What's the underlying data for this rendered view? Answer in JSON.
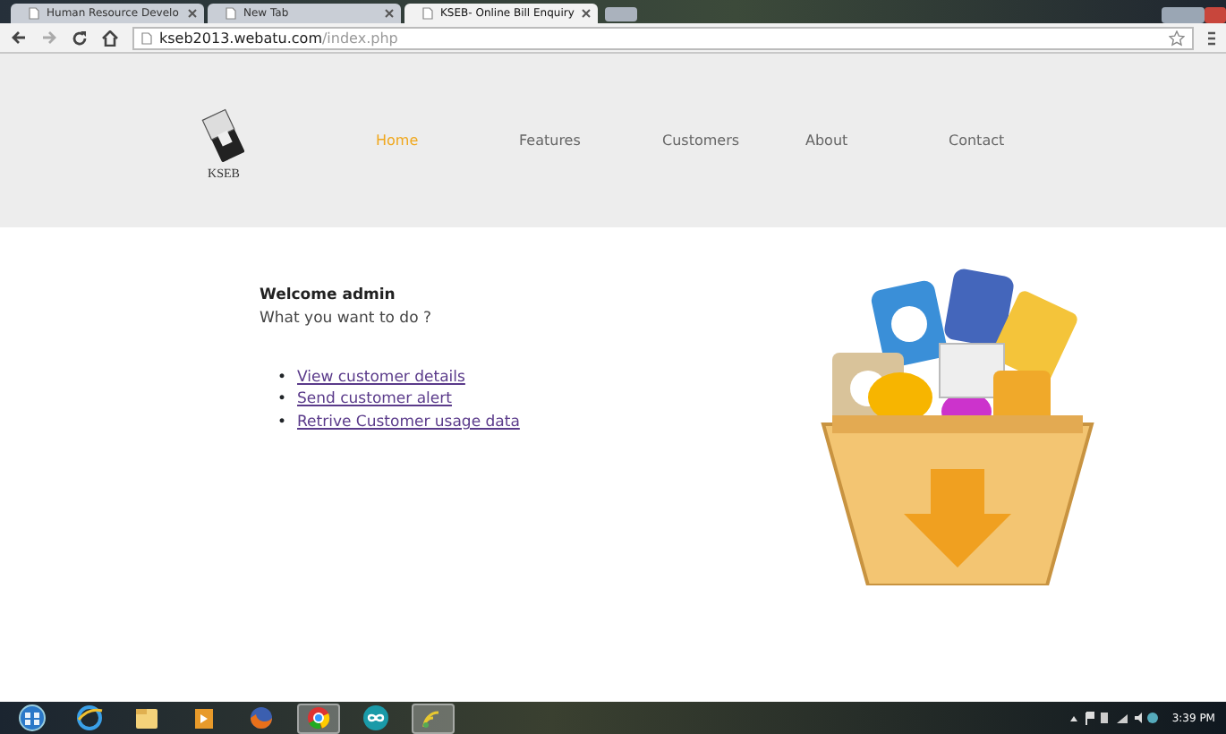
{
  "browser": {
    "tabs": [
      {
        "label": "Human Resource Develo",
        "selected": false
      },
      {
        "label": "New Tab",
        "selected": false
      },
      {
        "label": "KSEB- Online Bill Enquiry",
        "selected": true
      }
    ],
    "address": {
      "host": "kseb2013.webatu.com",
      "path": "/index.php"
    }
  },
  "site": {
    "logo_text": "KSEB",
    "nav": [
      {
        "label": "Home",
        "selected": true
      },
      {
        "label": "Features",
        "selected": false
      },
      {
        "label": "Customers",
        "selected": false
      },
      {
        "label": "About",
        "selected": false
      },
      {
        "label": "Contact",
        "selected": false
      }
    ]
  },
  "content": {
    "greeting": "Welcome admin",
    "prompt": "What you want to do ?",
    "links": [
      {
        "bullet": "•",
        "label": "View customer details"
      },
      {
        "bullet": "•",
        "label": "Send customer alert"
      },
      {
        "bullet": "•",
        "label": "Retrive Customer usage data"
      }
    ]
  },
  "taskbar": {
    "apps": [
      {
        "kind": "start",
        "running": false
      },
      {
        "kind": "globe",
        "running": false
      },
      {
        "kind": "folder",
        "running": false
      },
      {
        "kind": "media",
        "running": false
      },
      {
        "kind": "fox",
        "running": false
      },
      {
        "kind": "chrome",
        "running": true
      },
      {
        "kind": "infinity",
        "running": false
      },
      {
        "kind": "signal",
        "running": true
      }
    ],
    "clock": "3:39 PM"
  }
}
